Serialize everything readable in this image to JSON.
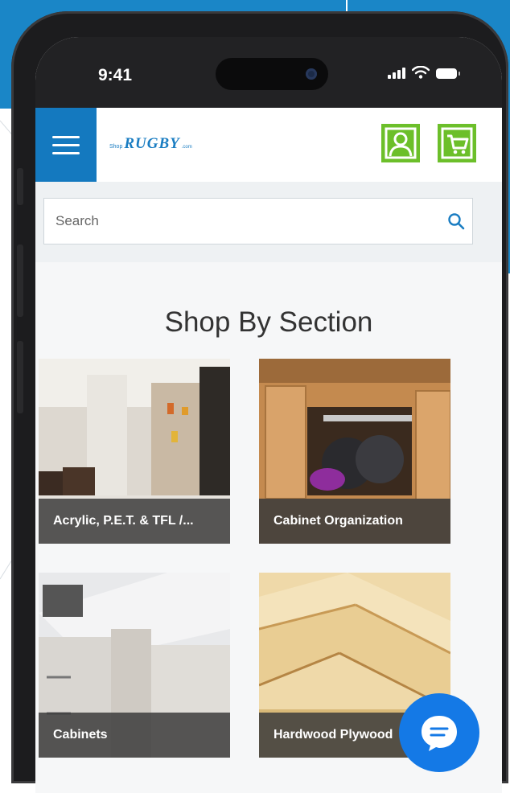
{
  "status_bar": {
    "time": "9:41"
  },
  "app_bar": {
    "logo": {
      "prefix": "Shop",
      "brand": "RUGBY",
      "suffix": ".com"
    }
  },
  "search": {
    "placeholder": "Search"
  },
  "main": {
    "title": "Shop By Section",
    "sections": [
      {
        "label": "Acrylic, P.E.T. & TFL /..."
      },
      {
        "label": "Cabinet Organization"
      },
      {
        "label": "Cabinets"
      },
      {
        "label": "Hardwood Plywood"
      }
    ]
  },
  "colors": {
    "brand_blue": "#1479bf",
    "accent_green": "#6cbf2a",
    "chat_blue": "#1479e6"
  },
  "icons": [
    "menu-icon",
    "user-icon",
    "cart-icon",
    "search-icon",
    "chat-icon",
    "signal-icon",
    "wifi-icon",
    "battery-icon"
  ]
}
